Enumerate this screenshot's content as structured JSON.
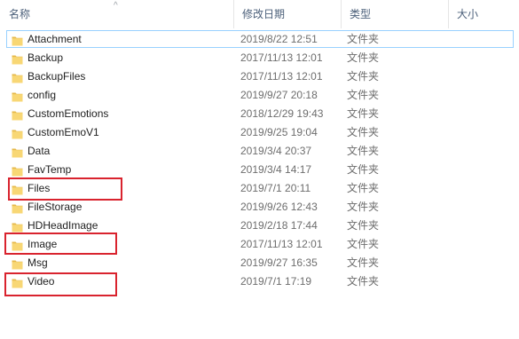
{
  "columns": {
    "name": "名称",
    "date": "修改日期",
    "type": "类型",
    "size": "大小"
  },
  "sort_indicator": "^",
  "rows": [
    {
      "name": "Attachment",
      "date": "2019/8/22 12:51",
      "type": "文件夹"
    },
    {
      "name": "Backup",
      "date": "2017/11/13 12:01",
      "type": "文件夹"
    },
    {
      "name": "BackupFiles",
      "date": "2017/11/13 12:01",
      "type": "文件夹"
    },
    {
      "name": "config",
      "date": "2019/9/27 20:18",
      "type": "文件夹"
    },
    {
      "name": "CustomEmotions",
      "date": "2018/12/29 19:43",
      "type": "文件夹"
    },
    {
      "name": "CustomEmoV1",
      "date": "2019/9/25 19:04",
      "type": "文件夹"
    },
    {
      "name": "Data",
      "date": "2019/3/4 20:37",
      "type": "文件夹"
    },
    {
      "name": "FavTemp",
      "date": "2019/3/4 14:17",
      "type": "文件夹"
    },
    {
      "name": "Files",
      "date": "2019/7/1 20:11",
      "type": "文件夹"
    },
    {
      "name": "FileStorage",
      "date": "2019/9/26 12:43",
      "type": "文件夹"
    },
    {
      "name": "HDHeadImage",
      "date": "2019/2/18 17:44",
      "type": "文件夹"
    },
    {
      "name": "Image",
      "date": "2017/11/13 12:01",
      "type": "文件夹"
    },
    {
      "name": "Msg",
      "date": "2019/9/27 16:35",
      "type": "文件夹"
    },
    {
      "name": "Video",
      "date": "2019/7/1 17:19",
      "type": "文件夹"
    }
  ],
  "icon": "folder-icon",
  "colors": {
    "folder": "#f8d775",
    "folder_dark": "#e6b84a",
    "highlight": "#d9232e",
    "selection": "#99d1ff"
  }
}
